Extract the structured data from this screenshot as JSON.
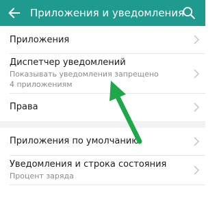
{
  "appbar": {
    "title": "Приложения и уведомления",
    "back_icon": "arrow-back-icon",
    "search_icon": "search-icon",
    "color": "#1f9a8e"
  },
  "items": [
    {
      "title": "Приложения"
    },
    {
      "title": "Диспетчер уведомлений",
      "subtitle1": "Показывать уведомления запрещено",
      "subtitle2": "4 приложениям"
    },
    {
      "title": "Права"
    },
    {
      "title": "Приложения по умолчанию"
    },
    {
      "title": "Уведомления и строка состояния",
      "subtitle1": "Процент заряда"
    }
  ],
  "annotation": {
    "icon": "green-pointer-arrow-icon",
    "color": "#1ea84a"
  }
}
